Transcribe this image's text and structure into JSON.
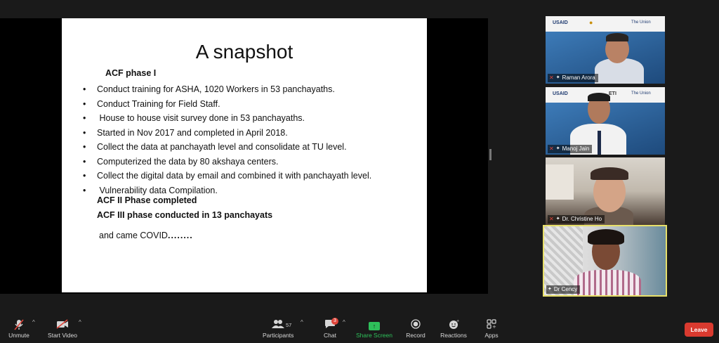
{
  "slide": {
    "title": "A snapshot",
    "phase_heading": "ACF phase I",
    "bullet_char": "•",
    "bullets": [
      "Conduct training for ASHA, 1020 Workers in 53 panchayaths.",
      "Conduct Training for Field Staff.",
      " House to house visit survey done in 53 panchayaths.",
      "Started in Nov 2017 and completed in April 2018.",
      "Collect the data at panchayath level and consolidate at TU level.",
      "Computerized the data by 80 akshaya centers.",
      "Collect the digital data by email and combined it with panchayath level.",
      " Vulnerability data Compilation."
    ],
    "phase2": "ACF II Phase completed",
    "phase3": "ACF III phase conducted in 13 panchayats",
    "closing": "and came COVID",
    "closing_dots": "........"
  },
  "participants": [
    {
      "name": "Raman Arora",
      "banner_left": "USAID",
      "banner_right": "The Union"
    },
    {
      "name": "Manoj Jain",
      "banner_left": "USAID",
      "banner_mid": "ETI",
      "banner_right": "The Union"
    },
    {
      "name": "Dr. Christine Ho"
    },
    {
      "name": "Dr Cency"
    }
  ],
  "toolbar": {
    "unmute": "Unmute",
    "start_video": "Start Video",
    "participants": "Participants",
    "participants_count": "57",
    "chat": "Chat",
    "chat_badge": "3",
    "share_screen": "Share Screen",
    "record": "Record",
    "reactions": "Reactions",
    "apps": "Apps",
    "leave": "Leave"
  },
  "colors": {
    "share_green": "#2ec05a",
    "leave_red": "#d93a2f",
    "active_speaker": "#e8e06a"
  }
}
